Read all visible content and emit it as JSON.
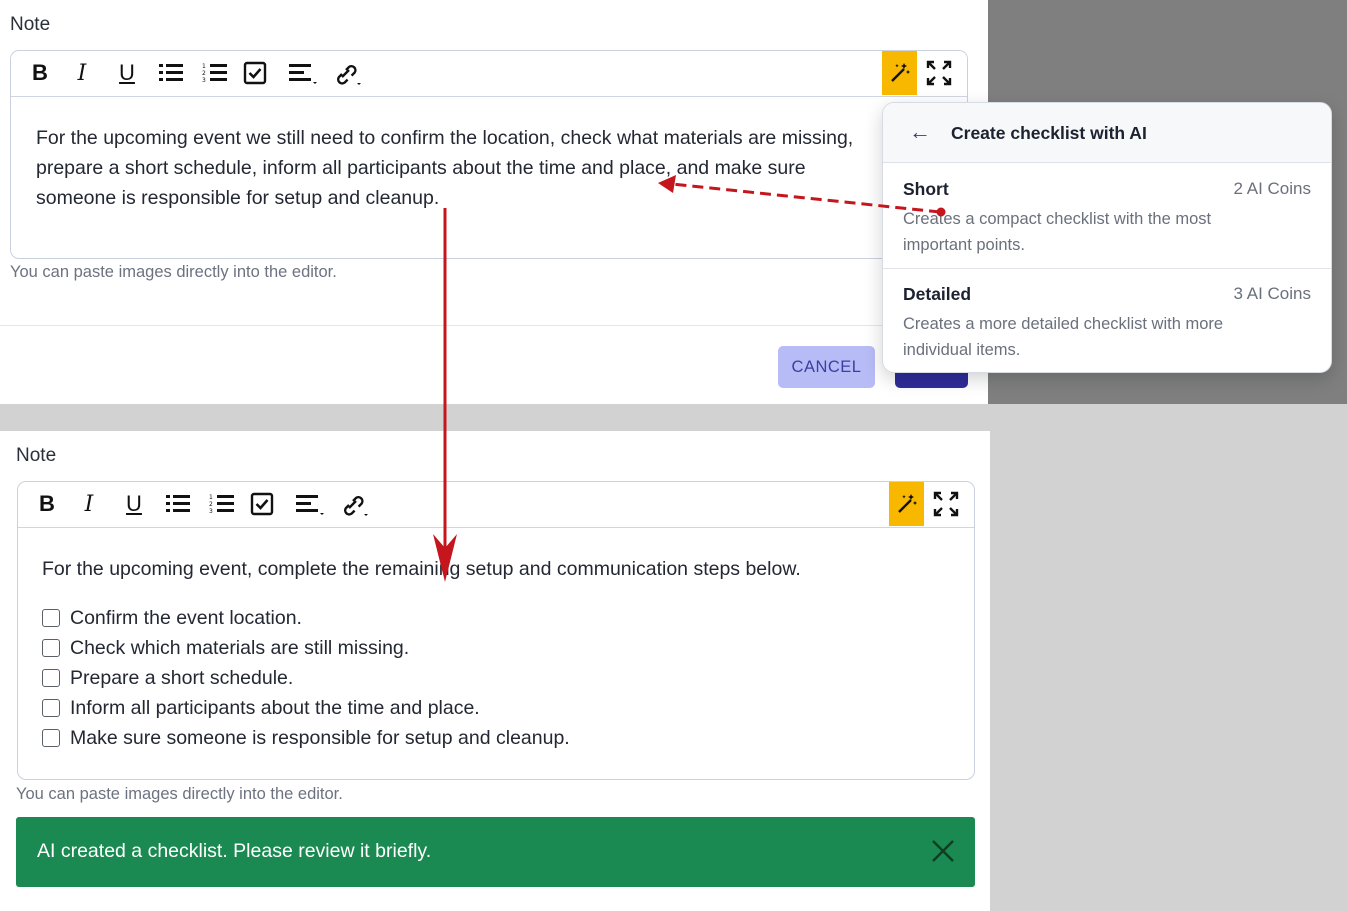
{
  "top": {
    "label": "Note",
    "editor_text_lines": [
      "For the upcoming event we still need to confirm the location, check what materials are missing,",
      "prepare a short schedule, inform all participants about the time and place, and make sure",
      "someone is responsible for setup and cleanup."
    ],
    "hint": "You can paste images directly into the editor.",
    "cancel_label": "CANCEL"
  },
  "toolbar": {
    "bold": "B",
    "italic": "I",
    "underline": "U"
  },
  "ai_menu": {
    "title": "Create checklist with AI",
    "back": "←",
    "options": [
      {
        "name": "Short",
        "cost": "2 AI Coins",
        "desc_lines": [
          "Creates a compact checklist with the most",
          "important points."
        ]
      },
      {
        "name": "Detailed",
        "cost": "3 AI Coins",
        "desc_lines": [
          "Creates a more detailed checklist with more",
          "individual items."
        ]
      }
    ]
  },
  "bottom": {
    "label": "Note",
    "intro": "For the upcoming event, complete the remaining setup and communication steps below.",
    "checklist": [
      "Confirm the event location.",
      "Check which materials are still missing.",
      "Prepare a short schedule.",
      "Inform all participants about the time and place.",
      "Make sure someone is responsible for setup and cleanup."
    ],
    "hint": "You can paste images directly into the editor.",
    "toast": "AI created a checklist. Please review it briefly."
  },
  "colors": {
    "wand_bg": "#f9b800",
    "toast_bg": "#1b8a52",
    "arrow": "#c4161c",
    "primary": "#2f2d9a",
    "cancel_bg": "#b8bcf6"
  }
}
